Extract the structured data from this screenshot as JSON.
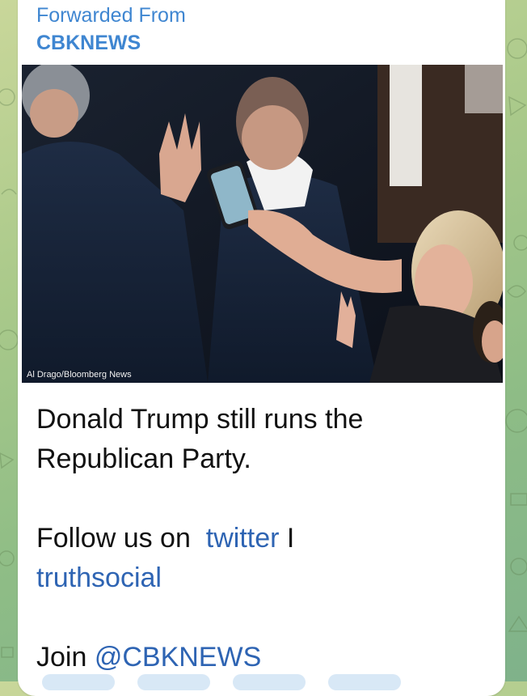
{
  "message": {
    "forwarded_label": "Forwarded From",
    "source_name": "CBKNEWS",
    "photo_credit": "Al Drago/Bloomberg News",
    "headline": "Donald Trump still runs the Republican Party.",
    "follow_prefix": "Follow us on",
    "twitter_link": "twitter",
    "separator": "I",
    "truthsocial_link": "truthsocial",
    "join_prefix": "Join",
    "channel_handle": "@CBKNEWS"
  },
  "colors": {
    "link": "#2e64b3",
    "forward_header": "#3f86d1",
    "bubble": "#ffffff"
  }
}
